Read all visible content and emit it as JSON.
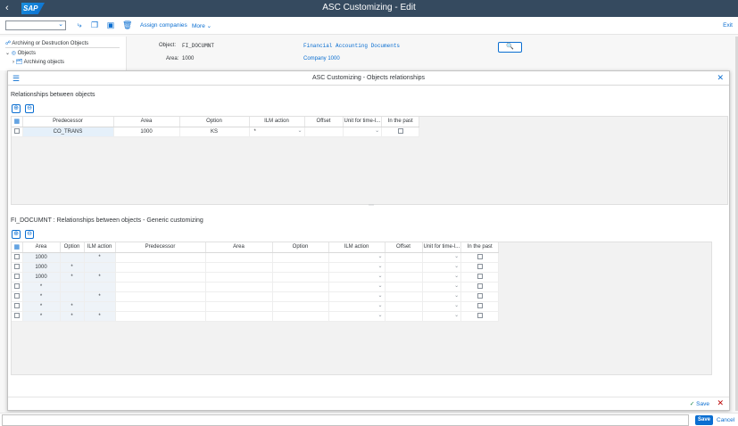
{
  "shell": {
    "logo": "SAP",
    "title": "ASC Customizing - Edit",
    "back_icon": "back-arrow-icon"
  },
  "toolbar": {
    "select_value": "",
    "assign_companies": "Assign companies",
    "more": "More",
    "exit": "Exit"
  },
  "tree": {
    "header": "Archiving or Destruction Objects",
    "objects": "Objects",
    "archiving_objects": "Archiving objects"
  },
  "object_info": {
    "object_label": "Object:",
    "object_value": "FI_DOCUMNT",
    "object_desc": "Financial Accounting Documents",
    "area_label": "Area:",
    "area_value": "1000",
    "area_desc": "Company 1000"
  },
  "dialog": {
    "title": "ASC Customizing - Objects relationships",
    "section1_title": "Relationships between objects",
    "section2_title": "FI_DOCUMNT : Relationships between objects - Generic customizing",
    "save": "Save"
  },
  "table1": {
    "headers": [
      "Predecessor",
      "Area",
      "Option",
      "ILM action",
      "Offset",
      "Unit for time-l...",
      "In the past"
    ],
    "rows": [
      {
        "predecessor": "CO_TRANS",
        "area": "1000",
        "option": "KS",
        "ilm_action": "*",
        "offset": "",
        "unit": ""
      }
    ]
  },
  "table2": {
    "headers": [
      "Area",
      "Option",
      "ILM action",
      "Predecessor",
      "Area",
      "Option",
      "ILM action",
      "Offset",
      "Unit for time-l...",
      "In the past"
    ],
    "rows": [
      {
        "area": "1000",
        "option": "",
        "ilm": "*"
      },
      {
        "area": "1000",
        "option": "*",
        "ilm": ""
      },
      {
        "area": "1000",
        "option": "*",
        "ilm": "*"
      },
      {
        "area": "*",
        "option": "",
        "ilm": ""
      },
      {
        "area": "*",
        "option": "",
        "ilm": "*"
      },
      {
        "area": "*",
        "option": "*",
        "ilm": ""
      },
      {
        "area": "*",
        "option": "*",
        "ilm": "*"
      }
    ]
  },
  "bottombar": {
    "save": "Save",
    "cancel": "Cancel"
  },
  "colors": {
    "shell_bg": "#354a5f",
    "accent": "#0a6ed1",
    "reject": "#bb0000"
  }
}
